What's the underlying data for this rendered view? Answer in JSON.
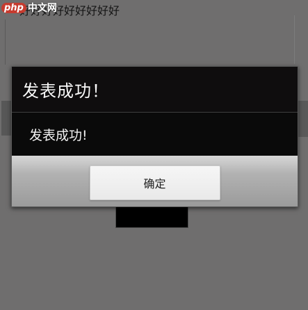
{
  "watermark": {
    "brand": "php",
    "site": "中文网"
  },
  "background": {
    "text": "好好好好好好好好好"
  },
  "dialog": {
    "title": "发表成功！",
    "message": "发表成功!",
    "ok_label": "确定"
  }
}
